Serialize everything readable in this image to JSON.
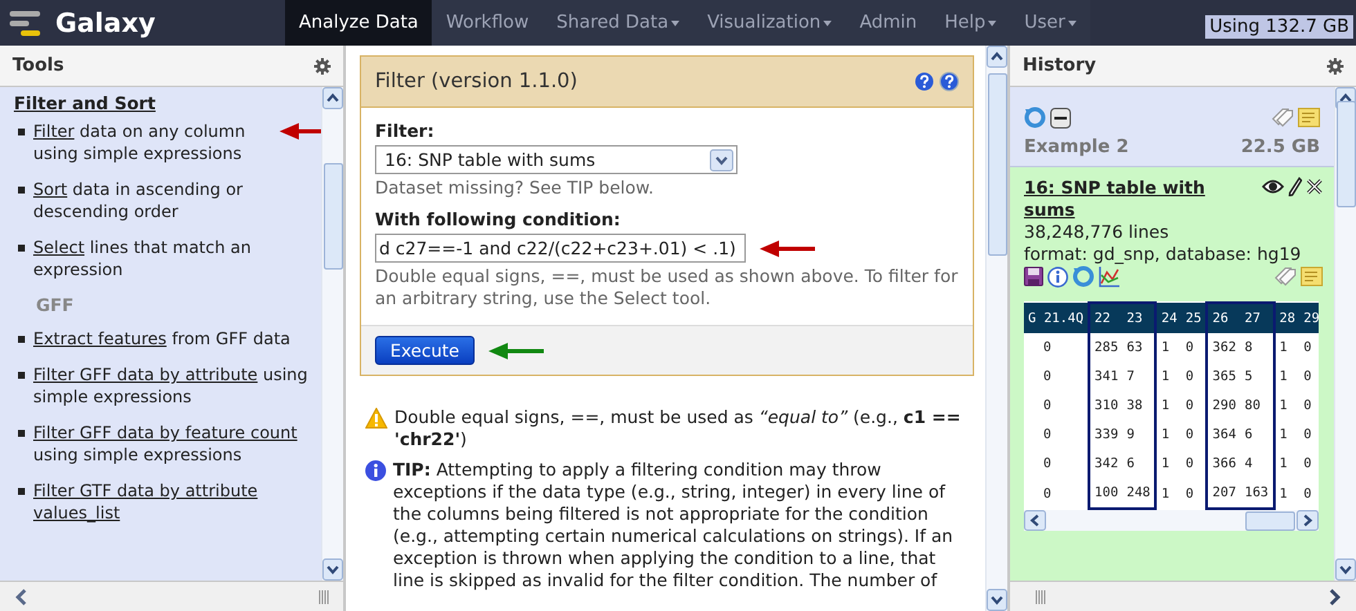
{
  "masthead": {
    "brand": "Galaxy",
    "nav": [
      {
        "label": "Analyze Data",
        "selected": true,
        "dropdown": false
      },
      {
        "label": "Workflow",
        "selected": false,
        "dropdown": false
      },
      {
        "label": "Shared Data",
        "selected": false,
        "dropdown": true
      },
      {
        "label": "Visualization",
        "selected": false,
        "dropdown": true
      },
      {
        "label": "Admin",
        "selected": false,
        "dropdown": false
      },
      {
        "label": "Help",
        "selected": false,
        "dropdown": true
      },
      {
        "label": "User",
        "selected": false,
        "dropdown": true
      }
    ],
    "usage": "Using 132.7 GB"
  },
  "tools": {
    "title": "Tools",
    "items": [
      {
        "kind": "section",
        "title": "Filter and Sort"
      },
      {
        "kind": "tool",
        "link": "Filter",
        "description": "data on any column using simple expressions",
        "arrow": {
          "color": "#c00000"
        }
      },
      {
        "kind": "tool",
        "link": "Sort",
        "description": "data in ascending or descending order"
      },
      {
        "kind": "tool",
        "link": "Select",
        "description": "lines that match an expression"
      },
      {
        "kind": "label",
        "title": "GFF"
      },
      {
        "kind": "tool",
        "link": "Extract features",
        "description": "from GFF data"
      },
      {
        "kind": "tool",
        "link": "Filter GFF data by attribute",
        "description": "using simple expressions"
      },
      {
        "kind": "tool",
        "link": "Filter GFF data by feature count",
        "description": "using simple expressions"
      },
      {
        "kind": "tool",
        "link": "Filter GTF data by attribute values_list"
      }
    ]
  },
  "tool_form": {
    "title": "Filter (version 1.1.0)",
    "fields": [
      {
        "kind": "select",
        "label": "Filter:",
        "value": "16: SNP table with sums",
        "help": "Dataset missing? See TIP below."
      },
      {
        "kind": "text",
        "label": "With following condition:",
        "value": "d c27==-1 and c22/(c22+c23+.01) < .1)",
        "help": "Double equal signs, ==, must be used as shown above. To filter for an arbitrary string, use the Select tool.",
        "arrow": {
          "color": "#c00000"
        }
      }
    ],
    "execute": {
      "label": "Execute",
      "arrow": {
        "color": "#118811"
      }
    },
    "notes": [
      {
        "kind": "warning",
        "text": "Double equal signs, ==, must be used as *“equal to”* (e.g., **c1 == 'chr22'**)"
      },
      {
        "kind": "info",
        "text": "**TIP:** Attempting to apply a filtering condition may throw exceptions if the data type (e.g., string, integer) in every line of the columns being filtered is not appropriate for the condition (e.g., attempting certain numerical calculations on strings). If an exception is thrown when applying the condition to a line, that line is skipped as invalid for the filter condition. The number of"
      }
    ]
  },
  "history": {
    "title": "History",
    "name": "Example 2",
    "size": "22.5 GB",
    "dataset": {
      "title": "16: SNP table with sums",
      "lines": "38,248,776 lines",
      "meta": "format: gd_snp, database: hg19",
      "peek": {
        "columns": [
          {
            "label": "G 21.4Q",
            "boxed": false
          },
          {
            "label": "22",
            "boxed": true
          },
          {
            "label": "23",
            "boxed": true
          },
          {
            "label": "24",
            "boxed": false
          },
          {
            "label": "25",
            "boxed": false
          },
          {
            "label": "26",
            "boxed": true
          },
          {
            "label": "27",
            "boxed": true
          },
          {
            "label": "28",
            "boxed": false
          },
          {
            "label": "29",
            "boxed": false
          }
        ],
        "rows": [
          [
            "0",
            "285",
            "63",
            "1",
            "0",
            "362",
            "8",
            "1",
            "0"
          ],
          [
            "0",
            "341",
            "7",
            "1",
            "0",
            "365",
            "5",
            "1",
            "0"
          ],
          [
            "0",
            "310",
            "38",
            "1",
            "0",
            "290",
            "80",
            "1",
            "0"
          ],
          [
            "0",
            "339",
            "9",
            "1",
            "0",
            "364",
            "6",
            "1",
            "0"
          ],
          [
            "0",
            "342",
            "6",
            "1",
            "0",
            "366",
            "4",
            "1",
            "0"
          ],
          [
            "0",
            "100",
            "248",
            "1",
            "0",
            "207",
            "163",
            "1",
            "0"
          ]
        ]
      }
    }
  }
}
